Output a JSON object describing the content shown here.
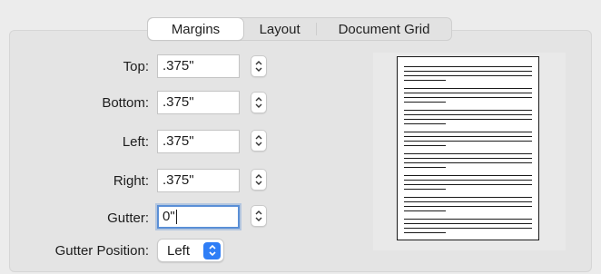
{
  "tabs": [
    {
      "label": "Margins",
      "active": true
    },
    {
      "label": "Layout",
      "active": false
    },
    {
      "label": "Document Grid",
      "active": false
    }
  ],
  "fields": {
    "top": {
      "label": "Top:",
      "value": ".375\""
    },
    "bottom": {
      "label": "Bottom:",
      "value": ".375\""
    },
    "left": {
      "label": "Left:",
      "value": ".375\""
    },
    "right": {
      "label": "Right:",
      "value": ".375\""
    },
    "gutter": {
      "label": "Gutter:",
      "value": "0\""
    }
  },
  "gutter_position": {
    "label": "Gutter Position:",
    "value": "Left"
  },
  "colors": {
    "accent": "#2f7ef6",
    "focus_ring": "#5a8fd6"
  },
  "icons": {
    "stepper": "up-down-stepper-icon",
    "popup": "chevron-up-down-icon"
  }
}
